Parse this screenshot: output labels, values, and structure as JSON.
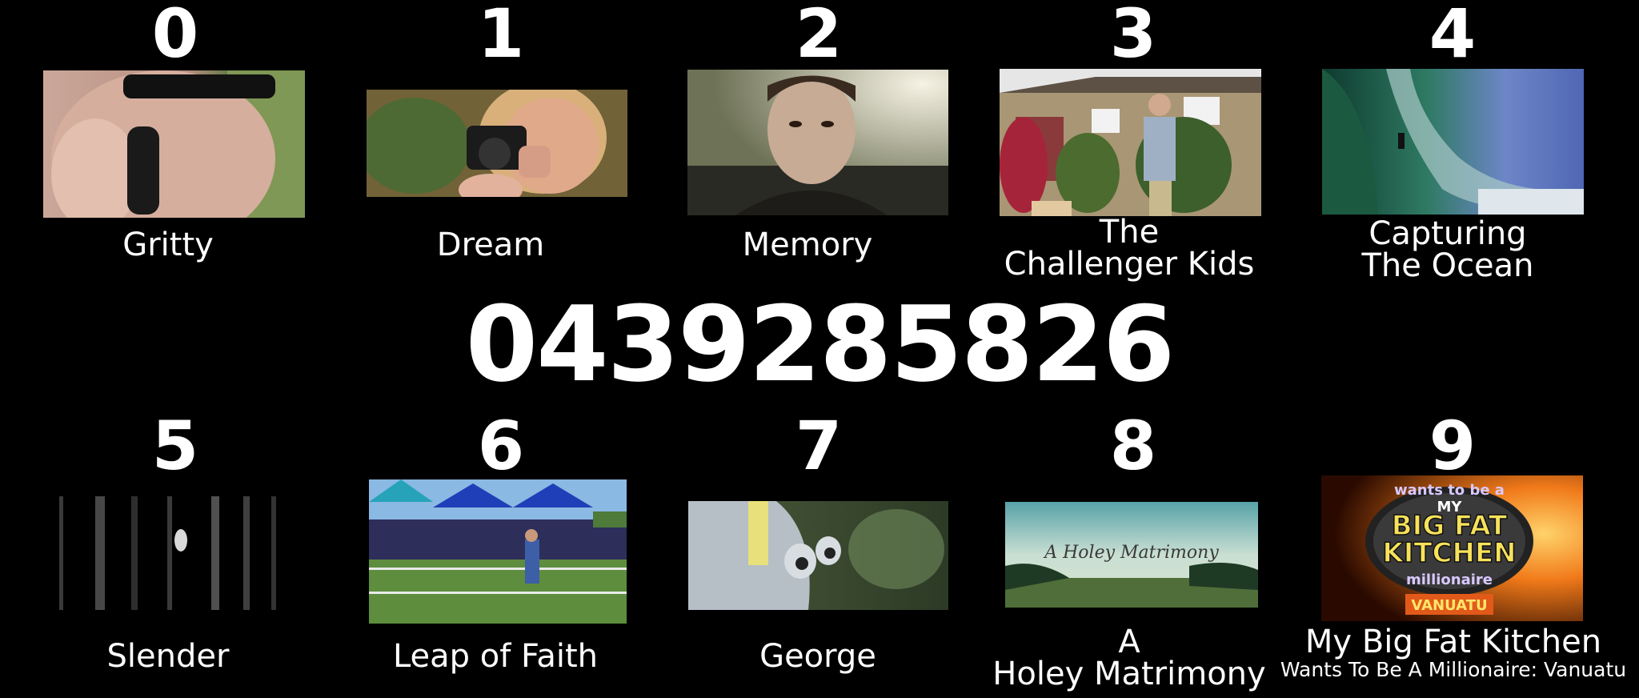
{
  "phone_number": "0439285826",
  "items": [
    {
      "digit": "0",
      "title": "Gritty"
    },
    {
      "digit": "1",
      "title": "Dream"
    },
    {
      "digit": "2",
      "title": "Memory"
    },
    {
      "digit": "3",
      "title": "The\nChallenger Kids"
    },
    {
      "digit": "4",
      "title": "Capturing\nThe Ocean"
    },
    {
      "digit": "5",
      "title": "Slender"
    },
    {
      "digit": "6",
      "title": "Leap of Faith"
    },
    {
      "digit": "7",
      "title": "George"
    },
    {
      "digit": "8",
      "title": "A\nHoley Matrimony"
    },
    {
      "digit": "9",
      "title": "My Big Fat Kitchen",
      "subtitle": "Wants To Be A Millionaire: Vanuatu"
    }
  ],
  "thumb_text": {
    "holey": "A Holey Matrimony",
    "kitchen_top": "wants to be a",
    "kitchen_my": "MY",
    "kitchen_big": "BIG FAT",
    "kitchen_k": "KITCHEN",
    "kitchen_m": "millionaire",
    "kitchen_v": "VANUATU"
  }
}
